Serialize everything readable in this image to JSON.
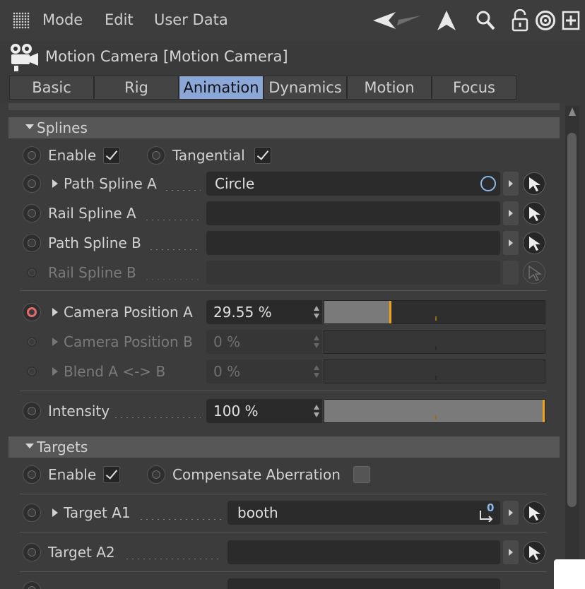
{
  "menubar": {
    "items": [
      "Mode",
      "Edit",
      "User Data"
    ]
  },
  "header": {
    "title": "Motion Camera [Motion Camera]"
  },
  "tabs": [
    "Basic",
    "Rig",
    "Animation",
    "Dynamics",
    "Motion",
    "Focus"
  ],
  "active_tab": "Animation",
  "splines": {
    "section_label": "Splines",
    "enable_label": "Enable",
    "enable_checked": true,
    "tangential_label": "Tangential",
    "tangential_checked": true,
    "path_spline_a_label": "Path Spline A",
    "path_spline_a_value": "Circle",
    "rail_spline_a_label": "Rail Spline A",
    "path_spline_b_label": "Path Spline B",
    "rail_spline_b_label": "Rail Spline B",
    "camera_position_a_label": "Camera Position A",
    "camera_position_a_value": "29.55 %",
    "camera_position_a_fraction": 0.2955,
    "camera_position_b_label": "Camera Position B",
    "camera_position_b_value": "0 %",
    "blend_label": "Blend A <-> B",
    "blend_value": "0 %",
    "intensity_label": "Intensity",
    "intensity_value": "100 %",
    "intensity_fraction": 1.0
  },
  "targets": {
    "section_label": "Targets",
    "enable_label": "Enable",
    "enable_checked": true,
    "compensate_label": "Compensate Aberration",
    "compensate_checked": false,
    "target_a1_label": "Target A1",
    "target_a1_value": "booth",
    "target_a1_badge": "0",
    "target_a2_label": "Target A2"
  },
  "colors": {
    "accent_tab": "#8aa7d8",
    "slider_knob": "#f2a10f",
    "keyframe_radio": "#e56a6a"
  }
}
